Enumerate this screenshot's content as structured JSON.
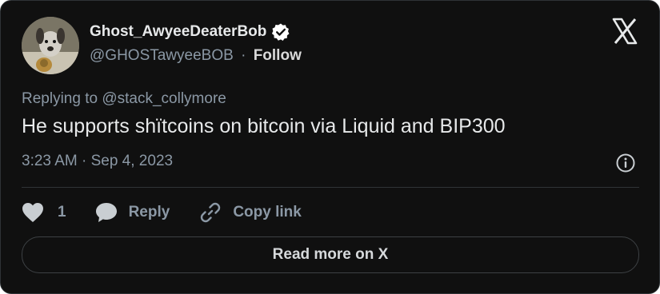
{
  "author": {
    "display_name": "Ghost_AwyeeDeaterBob",
    "handle": "@GHOSTawyeeBOB",
    "separator": "·",
    "follow_label": "Follow",
    "verified": true
  },
  "tweet": {
    "reply_to": "Replying to @stack_collymore",
    "text": "He supports shïtcoins on bitcoin via Liquid and BIP300",
    "timestamp": "3:23 AM · Sep 4, 2023"
  },
  "actions": {
    "like_count": "1",
    "reply_label": "Reply",
    "copy_label": "Copy link"
  },
  "read_more_label": "Read more on X",
  "icons": {
    "logo": "x-logo-icon",
    "verified": "verified-badge-icon",
    "info": "info-icon",
    "like": "heart-icon",
    "reply": "speech-bubble-icon",
    "copy": "link-icon"
  },
  "colors": {
    "card_background": "#101010",
    "primary_text": "#e7e9ea",
    "secondary_text": "#8b98a5",
    "border": "#2f3336"
  }
}
